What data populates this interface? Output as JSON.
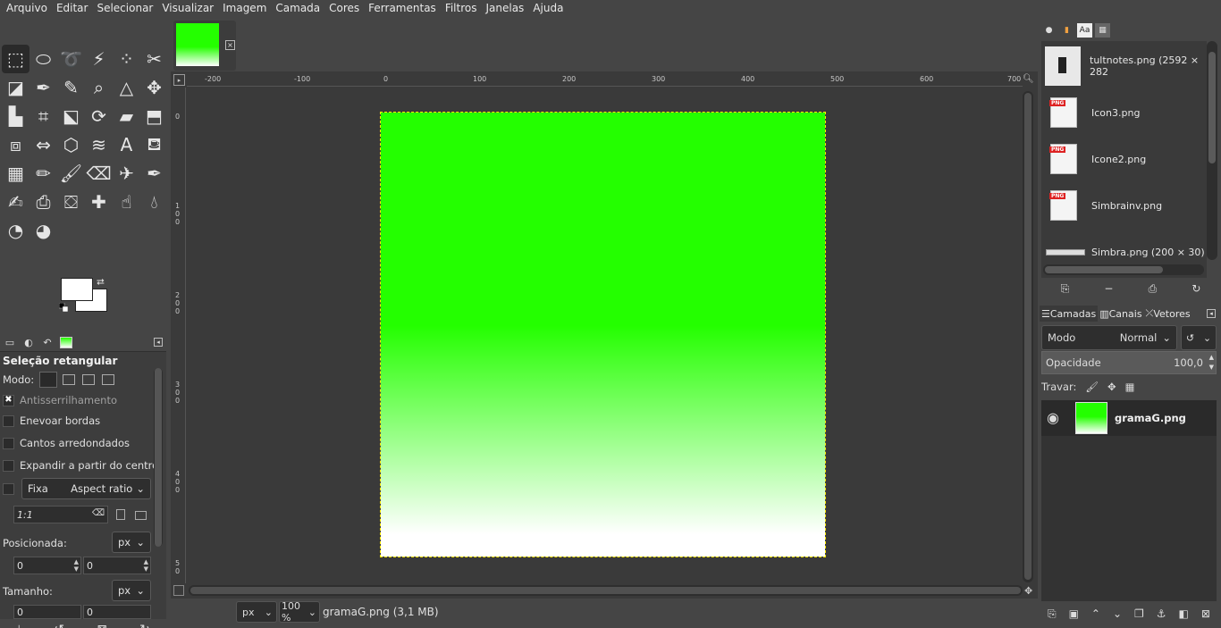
{
  "menubar": [
    "Arquivo",
    "Editar",
    "Selecionar",
    "Visualizar",
    "Imagem",
    "Camada",
    "Cores",
    "Ferramentas",
    "Filtros",
    "Janelas",
    "Ajuda"
  ],
  "toolbox": {
    "tools": [
      "rect-select-icon",
      "ellipse-select-icon",
      "free-select-icon",
      "fuzzy-select-icon",
      "select-by-color-icon",
      "scissors-select-icon",
      "foreground-select-icon",
      "paths-icon",
      "color-picker-icon",
      "zoom-icon",
      "measure-icon",
      "move-icon",
      "align-icon",
      "crop-icon",
      "unified-transform-icon",
      "rotate-icon",
      "shear-icon",
      "perspective-icon",
      "3d-transform-icon",
      "flip-icon",
      "cage-transform-icon",
      "warp-transform-icon",
      "text-icon",
      "bucket-fill-icon",
      "gradient-icon",
      "pencil-icon",
      "paintbrush-icon",
      "eraser-icon",
      "airbrush-icon",
      "ink-icon",
      "mypaint-brush-icon",
      "clone-icon",
      "perspective-clone-icon",
      "heal-icon",
      "smudge-icon",
      "blur-icon",
      "dodge-burn-icon",
      "dodge-icon2"
    ]
  },
  "tool_options": {
    "title": "Seleção retangular",
    "mode_label": "Modo:",
    "antialias": "Antisserrilhamento",
    "feather": "Enevoar bordas",
    "rounded": "Cantos arredondados",
    "expand": "Expandir a partir do centro",
    "fixed_label": "Fixa",
    "fixed_value": "Aspect ratio",
    "ratio_value": "1:1",
    "position_label": "Posicionada:",
    "position_unit": "px",
    "pos_x": "0",
    "pos_y": "0",
    "size_label": "Tamanho:",
    "size_unit": "px",
    "size_x": "0",
    "size_y": "0"
  },
  "canvas": {
    "ruler_h": [
      "-200",
      "-100",
      "0",
      "100",
      "200",
      "300",
      "400",
      "500",
      "600",
      "700"
    ],
    "ruler_v": [
      "0",
      "1\n0\n0",
      "2\n0\n0",
      "3\n0\n0",
      "4\n0\n0",
      "5\n0"
    ],
    "gradient_top": "#24ff00",
    "gradient_bottom": "#ffffff"
  },
  "status": {
    "unit": "px",
    "zoom": "100 %",
    "file": "gramaG.png (3,1 MB)"
  },
  "images_panel": [
    {
      "name": "tultnotes.png (2592 × 282",
      "type": "preview"
    },
    {
      "name": "Icon3.png",
      "type": "png"
    },
    {
      "name": "Icone2.png",
      "type": "png"
    },
    {
      "name": "Simbrainv.png",
      "type": "png"
    },
    {
      "name": "Simbra.png (200 × 30)",
      "type": "strip"
    }
  ],
  "layers_panel": {
    "tabs": [
      "Camadas",
      "Canais",
      "Vetores"
    ],
    "mode_label": "Modo",
    "mode_value": "Normal",
    "opacity_label": "Opacidade",
    "opacity_value": "100,0",
    "lock_label": "Travar:",
    "layer_name": "gramaG.png"
  }
}
